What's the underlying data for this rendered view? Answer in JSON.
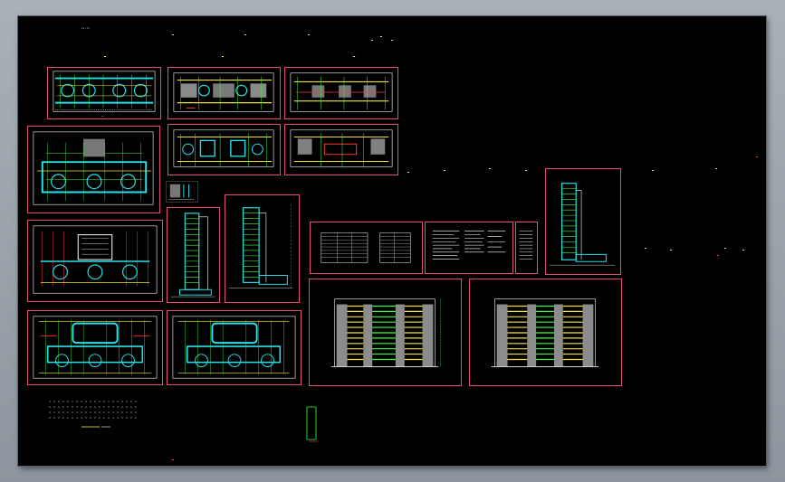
{
  "app": {
    "window_title": "",
    "colors": {
      "background": "#000000",
      "frame": "#9aa2ab",
      "sheet_border": "#e0507a",
      "cyan": "#27e0e8",
      "yellow": "#f2e33a",
      "green": "#3cff3c",
      "white": "#ffffff",
      "gray": "#9a9a9a",
      "red": "#ff3a3a",
      "blue": "#4a6cff"
    }
  },
  "canvas": {
    "header_text": "",
    "sheets": [
      {
        "id": "plan-1",
        "kind": "floor-plan",
        "label": ""
      },
      {
        "id": "plan-2",
        "kind": "floor-plan-gray",
        "label": ""
      },
      {
        "id": "plan-3",
        "kind": "floor-plan-gray",
        "label": ""
      },
      {
        "id": "plan-4",
        "kind": "floor-plan",
        "label": ""
      },
      {
        "id": "plan-5",
        "kind": "floor-plan",
        "label": ""
      },
      {
        "id": "plan-6",
        "kind": "floor-plan-gray",
        "label": ""
      },
      {
        "id": "plan-7",
        "kind": "floor-plan",
        "label": ""
      },
      {
        "id": "section-1",
        "kind": "section",
        "label": ""
      },
      {
        "id": "section-2",
        "kind": "section",
        "label": ""
      },
      {
        "id": "plan-8",
        "kind": "floor-plan",
        "label": ""
      },
      {
        "id": "plan-9",
        "kind": "floor-plan",
        "label": ""
      },
      {
        "id": "plan-10",
        "kind": "floor-plan",
        "label": ""
      },
      {
        "id": "table-1",
        "kind": "schedule",
        "label": ""
      },
      {
        "id": "table-2",
        "kind": "schedule",
        "label": ""
      },
      {
        "id": "table-3",
        "kind": "schedule",
        "label": ""
      },
      {
        "id": "section-3",
        "kind": "section",
        "label": ""
      },
      {
        "id": "elev-1",
        "kind": "elevation",
        "label": ""
      },
      {
        "id": "elev-2",
        "kind": "elevation",
        "label": ""
      }
    ]
  }
}
